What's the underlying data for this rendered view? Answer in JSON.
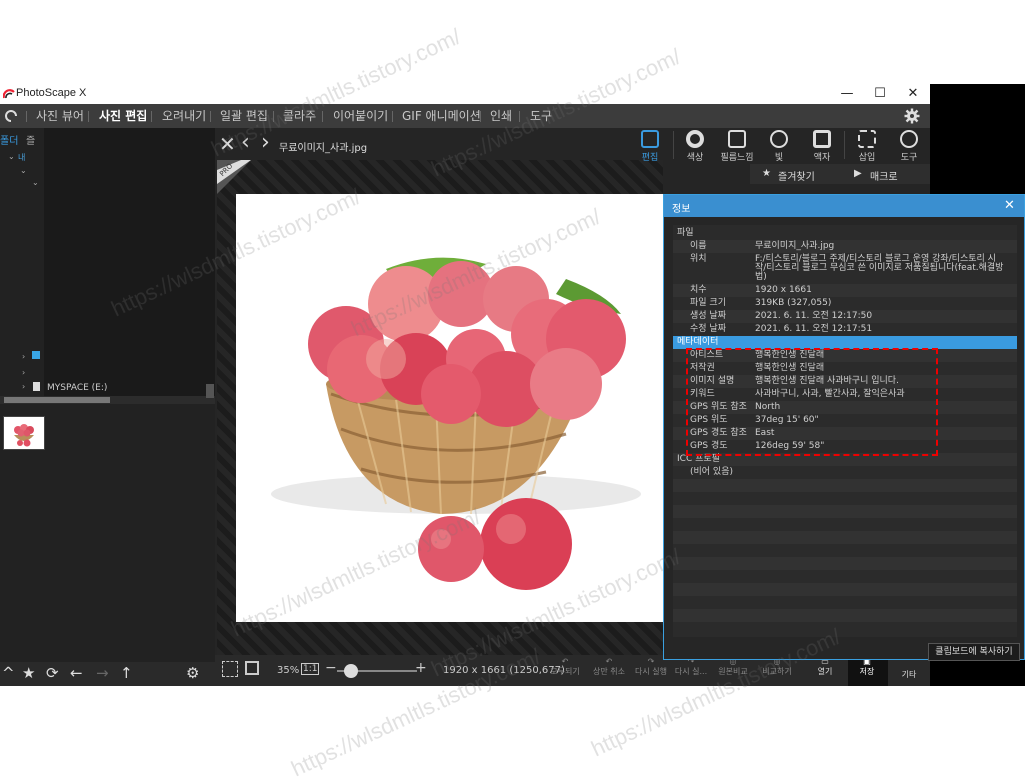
{
  "app": {
    "title": "PhotoScape X"
  },
  "window_buttons": {
    "minimize": "—",
    "maximize": "☐",
    "close": "✕"
  },
  "menu": {
    "items": [
      "사진 뷰어",
      "사진 편집",
      "오려내기",
      "일괄 편집",
      "콜라주",
      "이어붙이기",
      "GIF 애니메이션",
      "인쇄",
      "도구"
    ],
    "active": "사진 편집"
  },
  "left_panel": {
    "tabs": [
      "폴더",
      "즐겨"
    ],
    "drive_label": "MYSPACE (E:)",
    "tree_nodes": [
      "내",
      "",
      ""
    ]
  },
  "file_toolbar": {
    "filename": "무료이미지_사과.jpg"
  },
  "tools": [
    "편집",
    "색상",
    "필름느낌",
    "빛",
    "액자",
    "삽입",
    "도구"
  ],
  "fav_row": {
    "favorites": "즐겨찾기",
    "macro": "매크로"
  },
  "pro_badge": "PRO",
  "statusbar": {
    "zoom": "35%",
    "ratio_label": "1:1",
    "dimensions": "1920 x 1661 (1250,677)",
    "actions": [
      "모두되기",
      "상만 취소",
      "다시 실행",
      "다시 실...",
      "원본비교",
      "비교하기"
    ],
    "save_buttons": [
      "열기",
      "저장",
      "기타"
    ]
  },
  "info_panel": {
    "title": "정보",
    "file_section": "파일",
    "file_rows": [
      {
        "key": "이름",
        "value": "무료이미지_사과.jpg"
      },
      {
        "key": "위치",
        "value": "F:/티스토리/블로그 주제/티스토리 블로그 운영 강좌/티스토리 시"
      },
      {
        "key": "",
        "value": "작/티스토리 블로그 무심코 쓴 이미지로 저품질됩니다(feat.해결방"
      },
      {
        "key": "",
        "value": "법)"
      },
      {
        "key": "치수",
        "value": "1920 x 1661"
      },
      {
        "key": "파일 크기",
        "value": "319KB (327,055)"
      },
      {
        "key": "생성 날짜",
        "value": "2021. 6. 11. 오전 12:17:50"
      },
      {
        "key": "수정 날짜",
        "value": "2021. 6. 11. 오전 12:17:51"
      }
    ],
    "meta_section": "메타데이터",
    "meta_rows": [
      {
        "key": "아티스트",
        "value": "행복한인생 진달래"
      },
      {
        "key": "저작권",
        "value": "행복한인생 진달래"
      },
      {
        "key": "이미지 설명",
        "value": "행복한인생 진달래 사과바구니 입니다."
      },
      {
        "key": "키워드",
        "value": "사과바구니, 사과, 빨간사과, 잘익은사과"
      },
      {
        "key": "GPS 위도 참조",
        "value": "North"
      },
      {
        "key": "GPS 위도",
        "value": "37deg 15' 60\""
      },
      {
        "key": "GPS 경도 참조",
        "value": "East"
      },
      {
        "key": "GPS 경도",
        "value": "126deg 59' 58\""
      }
    ],
    "icc_section": "ICC 프로필",
    "icc_value": "(비어 있음)",
    "copy_button": "클립보드에 복사하기"
  },
  "watermark": "https://wlsdmltls.tistory.com/",
  "colors": {
    "accent": "#3a8fd0",
    "highlight_box": "#e00000",
    "menu_bg": "#3c3c3c"
  }
}
